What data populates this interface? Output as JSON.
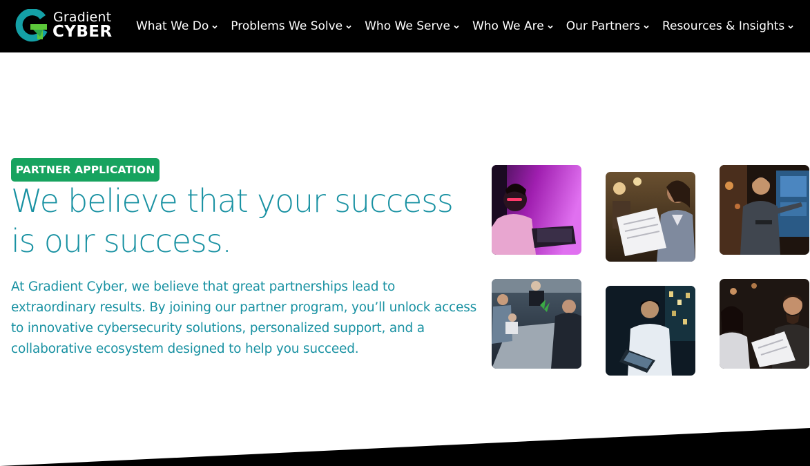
{
  "brand": {
    "line1": "Gradient",
    "line2": "CYBER",
    "colors": {
      "mark_teal": "#14a0a6",
      "mark_green": "#5cc83a"
    }
  },
  "nav": {
    "items": [
      {
        "label": "What We Do",
        "icon": "chevron-down-icon"
      },
      {
        "label": "Problems We Solve",
        "icon": "chevron-down-icon"
      },
      {
        "label": "Who We Serve",
        "icon": "chevron-down-icon"
      },
      {
        "label": "Who We Are",
        "icon": "chevron-down-icon"
      },
      {
        "label": "Our Partners",
        "icon": "chevron-down-icon"
      },
      {
        "label": "Resources & Insights",
        "icon": "chevron-down-icon"
      }
    ]
  },
  "hero": {
    "badge": "PARTNER APPLICATION",
    "headline_line1": "We believe that your success",
    "headline_line2": "is our success.",
    "body": "At Gradient Cyber, we believe that great partnerships lead to extraordinary results. By joining our partner program, you’ll unlock access to innovative cybersecurity solutions, personalized support, and a collaborative ecosystem designed to help you succeed."
  },
  "colors": {
    "header_bg": "#000000",
    "badge_bg": "#17a35f",
    "headline": "#1891a2",
    "body_text": "#1891a2",
    "page_bg": "#ffffff"
  }
}
